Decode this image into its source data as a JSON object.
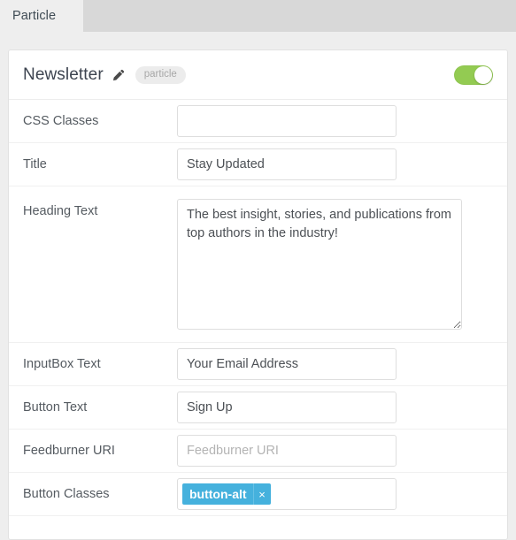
{
  "tabbar": {
    "tabs": [
      {
        "label": "Particle",
        "active": true
      }
    ]
  },
  "panel": {
    "title": "Newsletter",
    "edit_icon": "pencil-icon",
    "badge": "particle",
    "enabled_toggle": {
      "state": "on",
      "color": "#93cb52"
    },
    "accent_tag_color": "#45b1dd",
    "rows": [
      {
        "label": "CSS Classes",
        "type": "text",
        "value": "",
        "placeholder": ""
      },
      {
        "label": "Title",
        "type": "text",
        "value": "Stay Updated",
        "placeholder": ""
      },
      {
        "label": "Heading Text",
        "type": "textarea",
        "value": "The best insight, stories, and publications from top authors in the industry!",
        "placeholder": ""
      },
      {
        "label": "InputBox Text",
        "type": "text",
        "value": "Your Email Address",
        "placeholder": ""
      },
      {
        "label": "Button Text",
        "type": "text",
        "value": "Sign Up",
        "placeholder": ""
      },
      {
        "label": "Feedburner URI",
        "type": "text",
        "value": "",
        "placeholder": "Feedburner URI"
      },
      {
        "label": "Button Classes",
        "type": "tags",
        "tags": [
          {
            "label": "button-alt",
            "remove_icon": "×"
          }
        ]
      }
    ]
  }
}
